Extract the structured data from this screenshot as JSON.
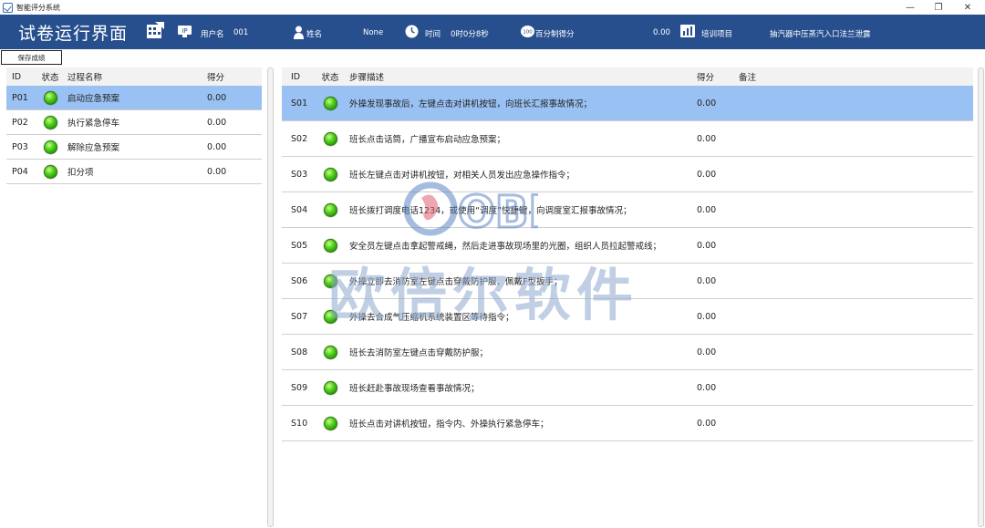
{
  "window": {
    "title": "智能评分系统"
  },
  "header": {
    "title": "试卷运行界面",
    "username_label": "用户名",
    "username_value": "001",
    "name_label": "姓名",
    "name_value": "None",
    "time_label": "时间",
    "time_value": "0时0分8秒",
    "percent_label": "百分制得分",
    "percent_badge": "100",
    "percent_value": "0.00",
    "training_label": "培训项目",
    "training_value": "抽汽器中压蒸汽入口法兰泄露",
    "ip_badge": "IP"
  },
  "toolbar": {
    "save_label": "保存成绩"
  },
  "process_table": {
    "headers": {
      "id": "ID",
      "status": "状态",
      "name": "过程名称",
      "score": "得分"
    },
    "rows": [
      {
        "id": "P01",
        "name": "启动应急预案",
        "score": "0.00"
      },
      {
        "id": "P02",
        "name": "执行紧急停车",
        "score": "0.00"
      },
      {
        "id": "P03",
        "name": "解除应急预案",
        "score": "0.00"
      },
      {
        "id": "P04",
        "name": "扣分项",
        "score": "0.00"
      }
    ]
  },
  "step_table": {
    "headers": {
      "id": "ID",
      "status": "状态",
      "desc": "步骤描述",
      "score": "得分",
      "note": "备注"
    },
    "rows": [
      {
        "id": "S01",
        "desc": "外操发现事故后，左键点击对讲机按钮，向班长汇报事故情况；",
        "score": "0.00"
      },
      {
        "id": "S02",
        "desc": "班长点击话筒，广播宣布启动应急预案；",
        "score": "0.00"
      },
      {
        "id": "S03",
        "desc": "班长左键点击对讲机按钮，对相关人员发出应急操作指令；",
        "score": "0.00"
      },
      {
        "id": "S04",
        "desc": "班长拨打调度电话1234，或使用“调度”快捷键，向调度室汇报事故情况；",
        "score": "0.00"
      },
      {
        "id": "S05",
        "desc": "安全员左键点击拿起警戒绳，然后走进事故现场里的光圈，组织人员拉起警戒线；",
        "score": "0.00"
      },
      {
        "id": "S06",
        "desc": "外操立即去消防室左键点击穿戴防护服、佩戴F型扳手；",
        "score": "0.00"
      },
      {
        "id": "S07",
        "desc": "外操去合成气压缩机系统装置区等待指令；",
        "score": "0.00"
      },
      {
        "id": "S08",
        "desc": "班长去消防室左键点击穿戴防护服；",
        "score": "0.00"
      },
      {
        "id": "S09",
        "desc": "班长赶赴事故现场查看事故情况；",
        "score": "0.00"
      },
      {
        "id": "S10",
        "desc": "班长点击对讲机按钮，指令内、外操执行紧急停车；",
        "score": "0.00"
      }
    ]
  },
  "watermark": {
    "logo_text": "OBR",
    "text": "欧倍尔软件"
  },
  "colors": {
    "header_bg": "#274f8e",
    "selected_row": "#99c1f3",
    "status_led": "#3fbf12"
  },
  "icons": {
    "user": "person-icon",
    "time": "clock-icon",
    "percent": "score-badge-icon",
    "training": "chart-icon",
    "app": "grid-icon"
  }
}
